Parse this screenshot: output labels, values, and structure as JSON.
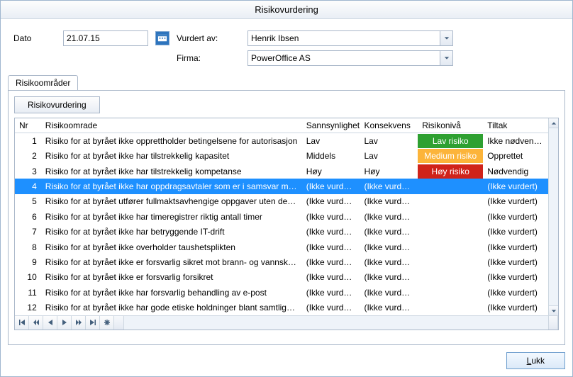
{
  "window": {
    "title": "Risikovurdering"
  },
  "form": {
    "date_label": "Dato",
    "date_value": "21.07.15",
    "vurdert_label": "Vurdert av:",
    "vurdert_value": "Henrik Ibsen",
    "firma_label": "Firma:",
    "firma_value": "PowerOffice AS"
  },
  "tab": {
    "label": "Risikoområder"
  },
  "toolbar": {
    "risiko_btn": "Risikovurdering"
  },
  "grid": {
    "headers": {
      "nr": "Nr",
      "omrade": "Risikoomrade",
      "sann": "Sannsynlighet",
      "kons": "Konsekvens",
      "niva": "Risikonivå",
      "tiltak": "Tiltak"
    },
    "rows": [
      {
        "nr": "1",
        "omrade": "Risiko for at byrået ikke opprettholder betingelsene for autorisasjon",
        "sann": "Lav",
        "kons": "Lav",
        "niva": "Lav risiko",
        "niva_class": "niva-low",
        "tiltak": "Ikke nødvendig",
        "selected": false
      },
      {
        "nr": "2",
        "omrade": "Risiko for at byrået ikke har tilstrekkelig kapasitet",
        "sann": "Middels",
        "kons": "Lav",
        "niva": "Medium risiko",
        "niva_class": "niva-med",
        "tiltak": "Opprettet",
        "selected": false
      },
      {
        "nr": "3",
        "omrade": "Risiko for at byrået ikke har tilstrekkelig kompetanse",
        "sann": "Høy",
        "kons": "Høy",
        "niva": "Høy risiko",
        "niva_class": "niva-high",
        "tiltak": "Nødvendig",
        "selected": false
      },
      {
        "nr": "4",
        "omrade": "Risiko for at byrået ikke har oppdragsavtaler som er i samsvar med oppd",
        "sann": "(Ikke vurdert)",
        "kons": "(Ikke vurdert)",
        "niva": "",
        "niva_class": "",
        "tiltak": "(Ikke vurdert)",
        "selected": true
      },
      {
        "nr": "5",
        "omrade": "Risiko for at byrået utfører fullmaktsavhengige oppgaver uten dekkende",
        "sann": "(Ikke vurdert)",
        "kons": "(Ikke vurdert)",
        "niva": "",
        "niva_class": "",
        "tiltak": "(Ikke vurdert)",
        "selected": false
      },
      {
        "nr": "6",
        "omrade": "Risiko for at byrået ikke har timeregistrer riktig antall timer",
        "sann": "(Ikke vurdert)",
        "kons": "(Ikke vurdert)",
        "niva": "",
        "niva_class": "",
        "tiltak": "(Ikke vurdert)",
        "selected": false
      },
      {
        "nr": "7",
        "omrade": "Risiko for at byrået ikke har betryggende IT-drift",
        "sann": "(Ikke vurdert)",
        "kons": "(Ikke vurdert)",
        "niva": "",
        "niva_class": "",
        "tiltak": "(Ikke vurdert)",
        "selected": false
      },
      {
        "nr": "8",
        "omrade": "Risiko for at byrået ikke overholder taushetsplikten",
        "sann": "(Ikke vurdert)",
        "kons": "(Ikke vurdert)",
        "niva": "",
        "niva_class": "",
        "tiltak": "(Ikke vurdert)",
        "selected": false
      },
      {
        "nr": "9",
        "omrade": "Risiko for at byrået ikke er forsvarlig sikret mot brann- og vannskader",
        "sann": "(Ikke vurdert)",
        "kons": "(Ikke vurdert)",
        "niva": "",
        "niva_class": "",
        "tiltak": "(Ikke vurdert)",
        "selected": false
      },
      {
        "nr": "10",
        "omrade": "Risiko for at byrået ikke er forsvarlig forsikret",
        "sann": "(Ikke vurdert)",
        "kons": "(Ikke vurdert)",
        "niva": "",
        "niva_class": "",
        "tiltak": "(Ikke vurdert)",
        "selected": false
      },
      {
        "nr": "11",
        "omrade": "Risiko for at byrået ikke har forsvarlig behandling av e-post",
        "sann": "(Ikke vurdert)",
        "kons": "(Ikke vurdert)",
        "niva": "",
        "niva_class": "",
        "tiltak": "(Ikke vurdert)",
        "selected": false
      },
      {
        "nr": "12",
        "omrade": "Risiko for at byrået ikke har gode etiske holdninger blant samtlige medarl",
        "sann": "(Ikke vurdert)",
        "kons": "(Ikke vurdert)",
        "niva": "",
        "niva_class": "",
        "tiltak": "(Ikke vurdert)",
        "selected": false
      }
    ]
  },
  "footer": {
    "close": "Lukk",
    "close_underline_prefix": "L",
    "close_rest": "ukk"
  }
}
